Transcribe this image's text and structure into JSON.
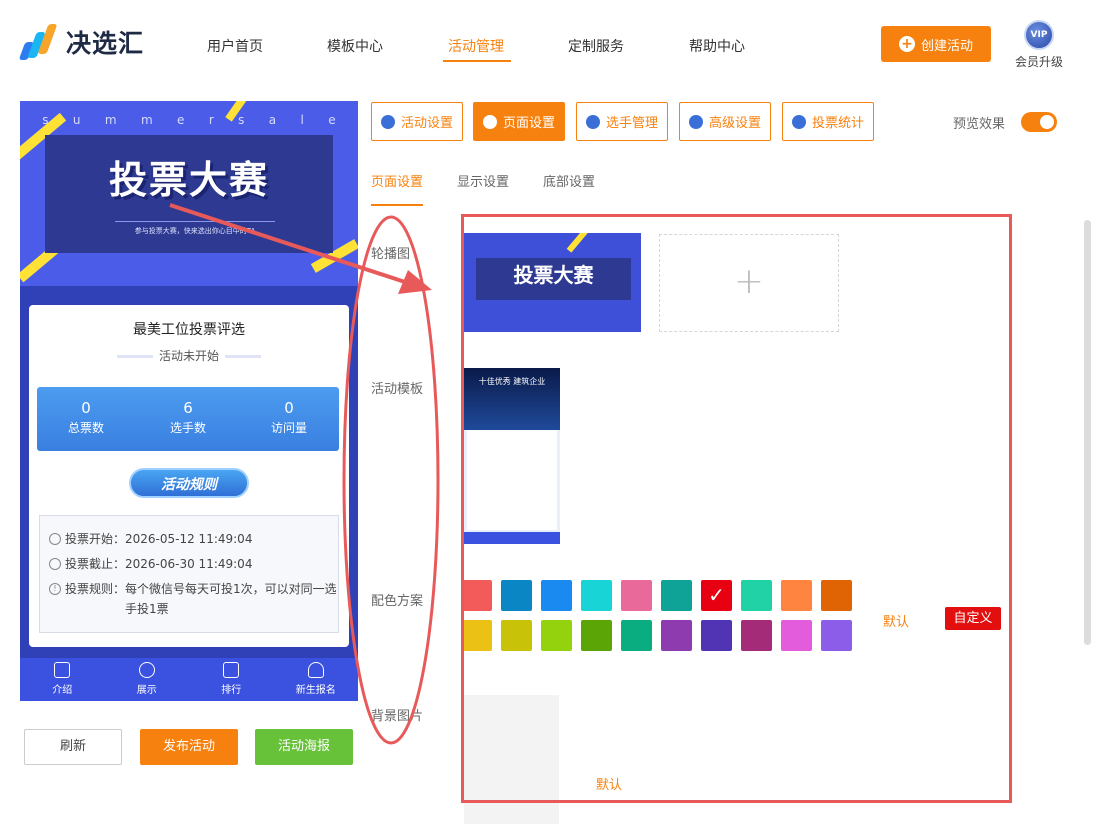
{
  "brand": {
    "name": "决选汇"
  },
  "nav": {
    "items": [
      "用户首页",
      "模板中心",
      "活动管理",
      "定制服务",
      "帮助中心"
    ],
    "active": "活动管理"
  },
  "header": {
    "create_label": "创建活动",
    "vip_badge": "VIP",
    "vip_label": "会员升级"
  },
  "preview": {
    "banner_word": [
      "s",
      "u",
      "m",
      "m",
      "e",
      "r",
      "s",
      "a",
      "l",
      "e"
    ],
    "banner_title": "投票大赛",
    "banner_sub": "参与投票大赛，快来选出你心目中的TA",
    "card_title": "最美工位投票评选",
    "status": "活动未开始",
    "stats": [
      {
        "value": "0",
        "label": "总票数"
      },
      {
        "value": "6",
        "label": "选手数"
      },
      {
        "value": "0",
        "label": "访问量"
      }
    ],
    "rules_button": "活动规则",
    "info": {
      "start": "投票开始：2026-05-12 11:49:04",
      "end": "投票截止：2026-06-30 11:49:04",
      "rule_line1": "投票规则：每个微信号每天可投1次，可以对同一选",
      "rule_line2": "手投1票"
    },
    "tabbar": [
      "介绍",
      "展示",
      "排行",
      "新生报名"
    ]
  },
  "actions": {
    "refresh": "刷新",
    "publish": "发布活动",
    "poster": "活动海报"
  },
  "toolbar": {
    "tabs": [
      "活动设置",
      "页面设置",
      "选手管理",
      "高级设置",
      "投票统计"
    ],
    "active": "页面设置",
    "preview_label": "预览效果",
    "preview_on": true
  },
  "subtabs": {
    "items": [
      "页面设置",
      "显示设置",
      "底部设置"
    ],
    "active": "页面设置"
  },
  "settings": {
    "carousel_label": "轮播图",
    "carousel_thumb_title": "投票大赛",
    "upload_symbol": "+",
    "template_label": "活动模板",
    "template_title": "十佳优秀 建筑企业",
    "color_label": "配色方案",
    "colors_row1": [
      "#f35a5a",
      "#0b86c4",
      "#1b8af0",
      "#18d4d6",
      "#e96a9a",
      "#0ea396",
      "#e60012",
      "#20d2a6",
      "#fe8440",
      "#e06404"
    ],
    "colors_row2": [
      "#ecc116",
      "#c8c209",
      "#94d20e",
      "#5ba606",
      "#0aad80",
      "#8e3bb0",
      "#5034b4",
      "#a32b78",
      "#e25cdc",
      "#8c5de8"
    ],
    "selected_color": "#e60012",
    "color_default": "默认",
    "color_custom": "自定义",
    "bg_label": "背景图片",
    "bg_default": "默认"
  }
}
